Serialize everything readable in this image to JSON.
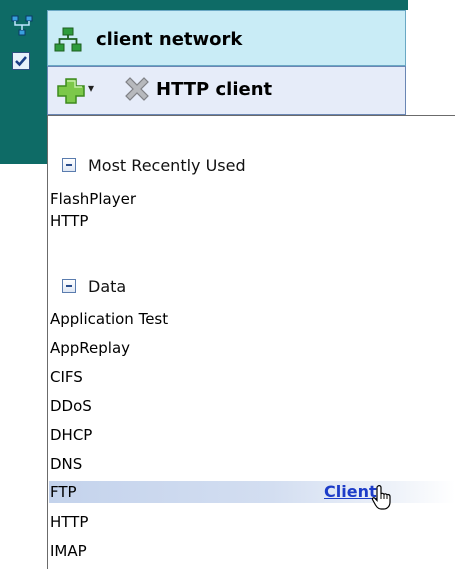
{
  "sidebar": {
    "icons": [
      "network-icon",
      "checkbox-icon"
    ],
    "checked": true
  },
  "header": {
    "network_label": "client network",
    "network_icon": "network-tree-icon",
    "add_icon": "green-plus-icon",
    "dropdown_icon": "chevron-down-icon",
    "remove_icon": "gray-x-icon",
    "client_label": "HTTP client"
  },
  "menu": {
    "group_recent": "Most Recently Used",
    "recent_items": [
      "FlashPlayer",
      "HTTP"
    ],
    "group_data": "Data",
    "data_items": [
      "Application Test",
      "AppReplay",
      "CIFS",
      "DDoS",
      "DHCP",
      "DNS",
      "FTP",
      "HTTP",
      "IMAP"
    ],
    "highlighted_item": "FTP",
    "hover_link": "Client",
    "cursor_icon": "hand-pointer-icon"
  },
  "colors": {
    "teal": "#0e6b66",
    "header_bg": "#c9ecf6",
    "toolbar_bg": "#e6ecf9",
    "link": "#1d3cc8",
    "highlight": "#c4d3ec"
  }
}
